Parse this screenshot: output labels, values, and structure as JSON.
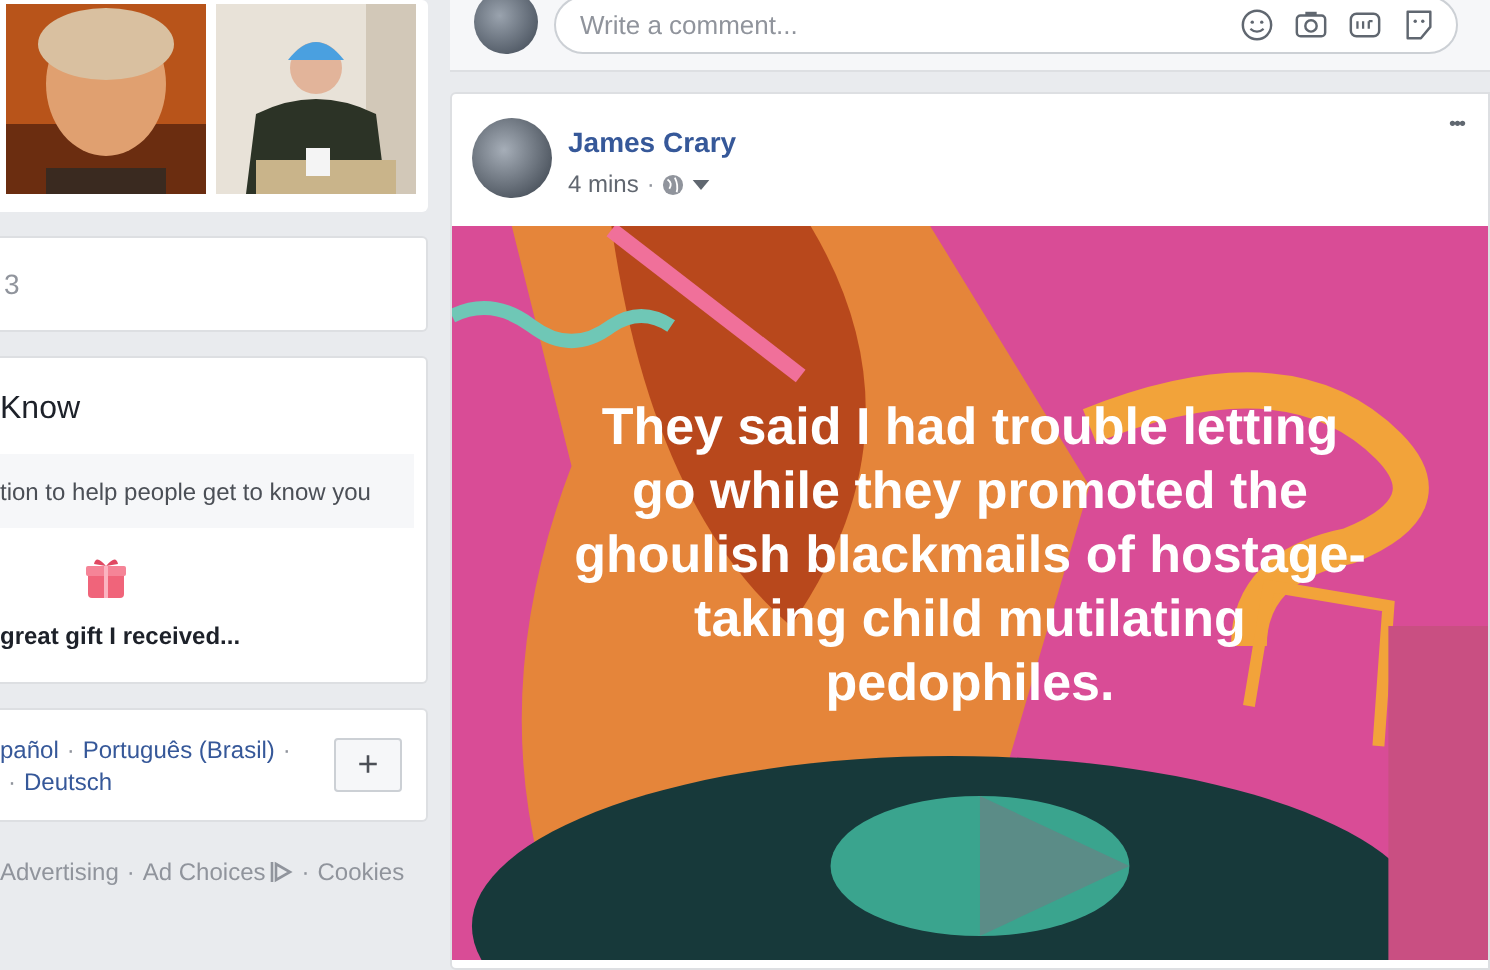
{
  "left": {
    "photos": [
      {
        "kind": "picture"
      },
      {
        "kind": "picture"
      }
    ],
    "count_card": "3",
    "intro_card": {
      "title": "Know",
      "hint": "tion to help people get to know you",
      "featured_caption": "great gift I received..."
    },
    "languages": [
      [
        {
          "kind": "link",
          "text": "pañol"
        },
        {
          "kind": "separator",
          "text": "·"
        },
        {
          "kind": "link",
          "text": "Português (Brasil)"
        },
        {
          "kind": "separator",
          "text": "·"
        }
      ],
      [
        {
          "kind": "separator",
          "text": "·"
        },
        {
          "kind": "link",
          "text": "Deutsch"
        }
      ]
    ],
    "add_language": "+",
    "footer_links": [
      {
        "kind": "link",
        "text": "Advertising"
      },
      {
        "kind": "separator",
        "text": "·"
      },
      {
        "kind": "adchoices",
        "text": "Ad Choices"
      },
      {
        "kind": "separator",
        "text": "·"
      },
      {
        "kind": "link",
        "text": "Cookies"
      }
    ]
  },
  "comment_box": {
    "placeholder": "Write a comment..."
  },
  "post": {
    "author": "James Crary",
    "time": "4 mins",
    "separator": "·",
    "menu": "•••",
    "image_text": "They said I had trouble letting go while they promoted the ghoulish blackmails of hostage-taking child mutilating pedophiles."
  }
}
